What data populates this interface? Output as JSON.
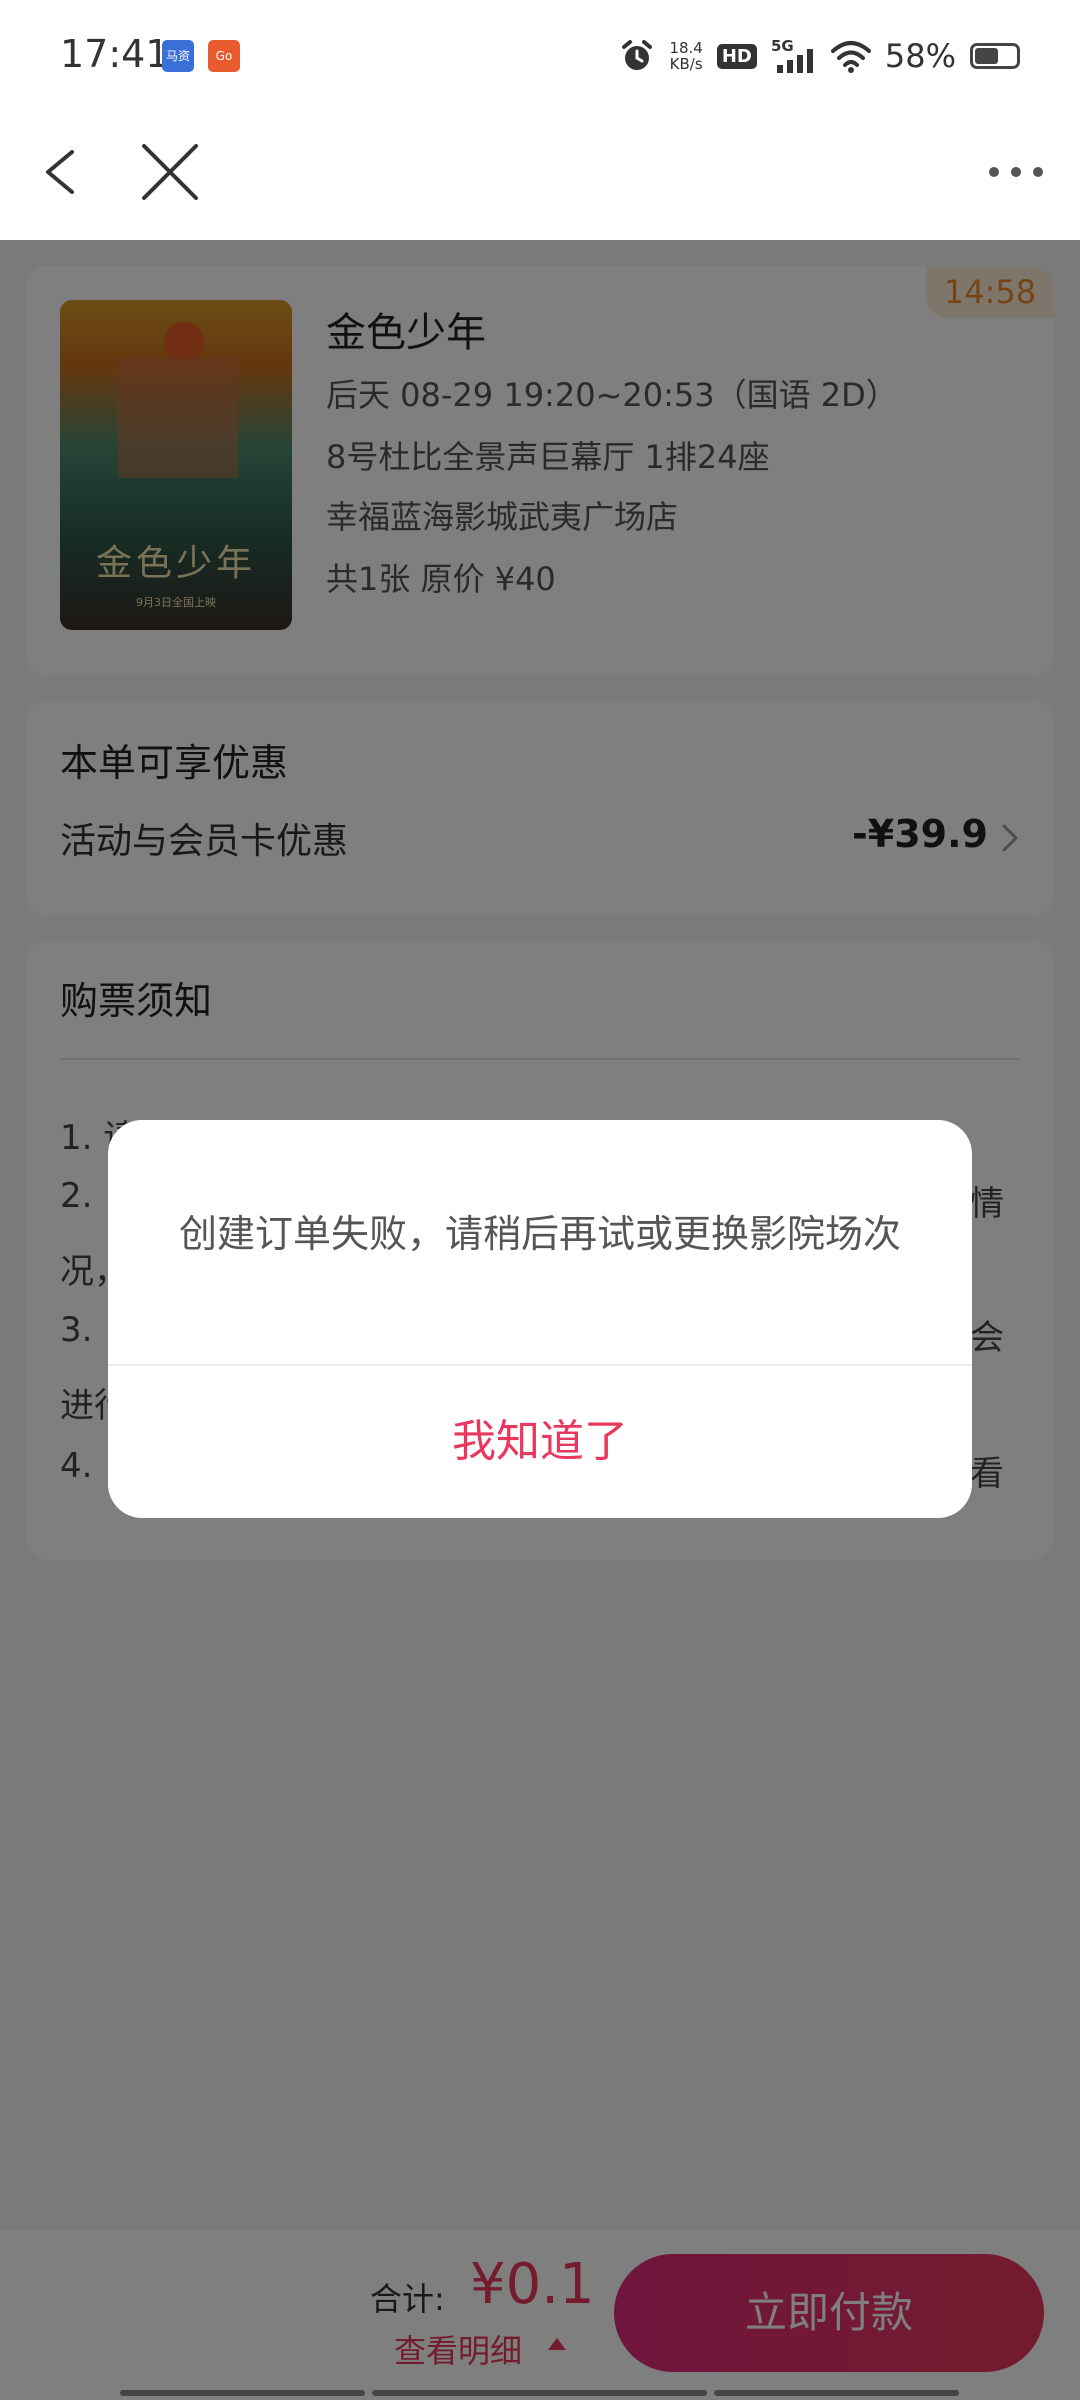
{
  "status_bar": {
    "time": "17:41",
    "app_icons": [
      "马资",
      "Go"
    ],
    "net_speed_value": "18.4",
    "net_speed_unit": "KB/s",
    "hd_label": "HD",
    "network": "5G",
    "battery_text": "58%",
    "battery_level": 0.58
  },
  "nav": {
    "icons": [
      "back-arrow-icon",
      "close-icon",
      "more-icon"
    ]
  },
  "order": {
    "countdown": "14:58",
    "poster_title": "金色少年",
    "poster_subtitle": "9月3日全国上映",
    "movie_title": "金色少年",
    "showtime": "后天 08-29 19:20~20:53（国语 2D）",
    "hall_seat": "8号杜比全景声巨幕厅 1排24座",
    "cinema": "幸福蓝海影城武夷广场店",
    "price_info": "共1张 原价 ¥40"
  },
  "discount": {
    "title": "本单可享优惠",
    "label": "活动与会员卡优惠",
    "value": "-¥39.9"
  },
  "notice": {
    "title": "购票须知",
    "line1": "1. 请确认场次和时间无误",
    "line2_start": "2.",
    "line2_end": "情",
    "line3_start": "况，",
    "line4_start": "3.",
    "line4_end": "会",
    "line5_start": "进行",
    "line6_start": "4.",
    "line6_end": "看"
  },
  "bottom": {
    "total_label": "合计:",
    "total_value": "¥0.1",
    "detail_link": "查看明细",
    "pay_button": "立即付款"
  },
  "dialog": {
    "message": "创建订单失败，请稍后再试或更换影院场次",
    "button": "我知道了"
  },
  "colors": {
    "accent": "#e8385d",
    "countdown_bg": "#fdebd7",
    "countdown_text": "#ee8a2a",
    "page_bg": "#f5f5f7"
  }
}
